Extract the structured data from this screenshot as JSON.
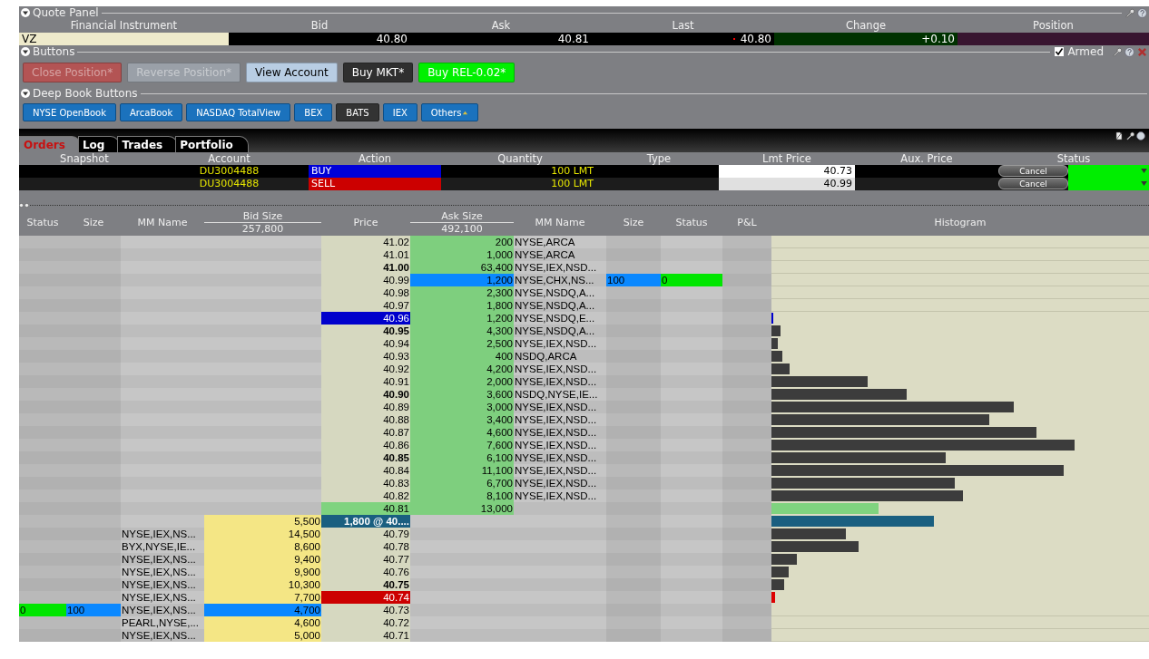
{
  "quote_panel": {
    "title": "Quote Panel",
    "expanded": true,
    "columns": [
      "Financial Instrument",
      "Bid",
      "Ask",
      "Last",
      "Change",
      "Position"
    ],
    "cells": [
      {
        "kind": "symbol",
        "text": "VZ"
      },
      {
        "kind": "price",
        "text": "40.80"
      },
      {
        "kind": "price",
        "text": "40.81"
      },
      {
        "kind": "last",
        "text": "40.80"
      },
      {
        "kind": "change",
        "text": "+0.10"
      },
      {
        "kind": "position"
      }
    ]
  },
  "buttons_panel": {
    "title": "Buttons",
    "expanded": true,
    "armed": {
      "label": "Armed",
      "checked": true
    },
    "buttons": [
      {
        "label": "Close Position*",
        "color": "#b35454",
        "disabled": true
      },
      {
        "label": "Reverse Position*",
        "color": "#9aa0a8",
        "disabled": true
      },
      {
        "label": "View Account",
        "color": "#b8cde3",
        "disabled": false
      },
      {
        "label": "Buy MKT*",
        "color": "#2f2f2f",
        "disabled": false
      },
      {
        "label": "Buy REL-0.02*",
        "color": "#00f000",
        "disabled": false
      }
    ]
  },
  "deep_book_panel": {
    "title": "Deep Book Buttons",
    "expanded": true,
    "buttons": [
      {
        "label": "NYSE OpenBook",
        "selected": false
      },
      {
        "label": "ArcaBook",
        "selected": false
      },
      {
        "label": "NASDAQ TotalView",
        "selected": false
      },
      {
        "label": "BEX",
        "selected": false
      },
      {
        "label": "BATS",
        "selected": true
      },
      {
        "label": "IEX",
        "selected": false
      },
      {
        "label": "Others",
        "selected": false,
        "menu": true
      }
    ]
  },
  "orders": {
    "tabs": [
      {
        "label": "Orders",
        "selected": true
      },
      {
        "label": "Log",
        "selected": false
      },
      {
        "label": "Trades",
        "selected": false
      },
      {
        "label": "Portfolio",
        "selected": false
      }
    ],
    "columns": [
      "Snapshot",
      "Account",
      "Action",
      "Quantity",
      "Type",
      "Lmt Price",
      "Aux. Price",
      "Status"
    ],
    "rows": [
      {
        "account": "DU3004488",
        "action": "BUY",
        "kind": "buy",
        "quantity": "100 LMT",
        "lmt_price": "40.73",
        "cancel": "Cancel",
        "color": "#00ee00"
      },
      {
        "account": "DU3004488",
        "action": "SELL",
        "kind": "sell",
        "quantity": "100 LMT",
        "lmt_price": "40.99",
        "cancel": "Cancel",
        "color": "#00ee00"
      }
    ]
  },
  "book": {
    "columns": [
      {
        "label": "Status"
      },
      {
        "label": "Size"
      },
      {
        "label": "MM Name"
      },
      {
        "label": "Bid Size",
        "total": "257,800"
      },
      {
        "label": "Price"
      },
      {
        "label": "Ask Size",
        "total": "492,100"
      },
      {
        "label": "MM Name"
      },
      {
        "label": "Size"
      },
      {
        "label": "Status"
      },
      {
        "label": "P&L"
      },
      {
        "label": "Histogram"
      }
    ],
    "rows": [
      {
        "kind": "ask",
        "price": "41.02",
        "bold": false,
        "size": "200",
        "mm": "NYSE,ARCA"
      },
      {
        "kind": "ask",
        "price": "41.01",
        "bold": false,
        "size": "1,000",
        "mm": "NYSE,ARCA"
      },
      {
        "kind": "ask",
        "price": "41.00",
        "bold": true,
        "size": "63,400",
        "mm": "NYSE,IEX,NSD..."
      },
      {
        "kind": "ask",
        "price": "40.99",
        "bold": false,
        "size": "1,200",
        "mm": "NYSE,CHX,NS...",
        "order": {
          "size": "100",
          "status": "0"
        }
      },
      {
        "kind": "ask",
        "price": "40.98",
        "bold": false,
        "size": "2,300",
        "mm": "NYSE,NSDQ,A..."
      },
      {
        "kind": "ask",
        "price": "40.97",
        "bold": false,
        "size": "1,800",
        "mm": "NYSE,NSDQ,A..."
      },
      {
        "kind": "ask",
        "price": "40.96",
        "bold": false,
        "size": "1,200",
        "mm": "NYSE,NSDQ,E...",
        "highlight": {
          "color": "#0000cc"
        },
        "histogram": {
          "level": 0.005,
          "color": "#0000cc"
        }
      },
      {
        "kind": "ask",
        "price": "40.95",
        "bold": true,
        "size": "4,300",
        "mm": "NYSE,NSDQ,A...",
        "histogram": {
          "level": 0.024,
          "color": "#3c3c3c"
        }
      },
      {
        "kind": "ask",
        "price": "40.94",
        "bold": false,
        "size": "2,500",
        "mm": "NYSE,IEX,NSD...",
        "histogram": {
          "level": 0.017,
          "color": "#3c3c3c"
        }
      },
      {
        "kind": "ask",
        "price": "40.93",
        "bold": false,
        "size": "400",
        "mm": "NSDQ,ARCA",
        "histogram": {
          "level": 0.029,
          "color": "#3c3c3c"
        }
      },
      {
        "kind": "ask",
        "price": "40.92",
        "bold": false,
        "size": "4,200",
        "mm": "NYSE,IEX,NSD...",
        "histogram": {
          "level": 0.049,
          "color": "#3c3c3c"
        }
      },
      {
        "kind": "ask",
        "price": "40.91",
        "bold": false,
        "size": "2,000",
        "mm": "NYSE,IEX,NSD...",
        "histogram": {
          "level": 0.255,
          "color": "#3c3c3c"
        }
      },
      {
        "kind": "ask",
        "price": "40.90",
        "bold": true,
        "size": "3,600",
        "mm": "NSDQ,NYSE,IE...",
        "histogram": {
          "level": 0.359,
          "color": "#3c3c3c"
        }
      },
      {
        "kind": "ask",
        "price": "40.89",
        "bold": false,
        "size": "3,000",
        "mm": "NYSE,IEX,NSD...",
        "histogram": {
          "level": 0.643,
          "color": "#3c3c3c"
        }
      },
      {
        "kind": "ask",
        "price": "40.88",
        "bold": false,
        "size": "3,400",
        "mm": "NYSE,IEX,NSD...",
        "histogram": {
          "level": 0.578,
          "color": "#3c3c3c"
        }
      },
      {
        "kind": "ask",
        "price": "40.87",
        "bold": false,
        "size": "4,600",
        "mm": "NYSE,IEX,NSD...",
        "histogram": {
          "level": 0.701,
          "color": "#3c3c3c"
        }
      },
      {
        "kind": "ask",
        "price": "40.86",
        "bold": false,
        "size": "7,600",
        "mm": "NYSE,IEX,NSD...",
        "histogram": {
          "level": 0.803,
          "color": "#3c3c3c"
        }
      },
      {
        "kind": "ask",
        "price": "40.85",
        "bold": true,
        "size": "6,100",
        "mm": "NYSE,IEX,NSD...",
        "histogram": {
          "level": 0.461,
          "color": "#3c3c3c"
        }
      },
      {
        "kind": "ask",
        "price": "40.84",
        "bold": false,
        "size": "11,100",
        "mm": "NYSE,IEX,NSD...",
        "histogram": {
          "level": 0.774,
          "color": "#3c3c3c"
        }
      },
      {
        "kind": "ask",
        "price": "40.83",
        "bold": false,
        "size": "6,700",
        "mm": "NYSE,IEX,NSD...",
        "histogram": {
          "level": 0.485,
          "color": "#3c3c3c"
        }
      },
      {
        "kind": "ask",
        "price": "40.82",
        "bold": false,
        "size": "8,100",
        "mm": "NYSE,IEX,NSD...",
        "histogram": {
          "level": 0.507,
          "color": "#3c3c3c"
        }
      },
      {
        "kind": "best_ask",
        "price": "40.81",
        "bold": false,
        "size": "13,000",
        "histogram": {
          "level": 0.284,
          "color": "#7fd37f"
        }
      },
      {
        "kind": "last",
        "price": "1,800 @ 40....",
        "bold": true,
        "size": "5,500",
        "histogram": {
          "level": 0.43,
          "color": "#1a5f80"
        }
      },
      {
        "kind": "bid",
        "price": "40.79",
        "bold": false,
        "size": "14,500",
        "mm": "NYSE,IEX,NS...",
        "histogram": {
          "level": 0.197,
          "color": "#3c3c3c"
        }
      },
      {
        "kind": "bid",
        "price": "40.78",
        "bold": false,
        "size": "8,600",
        "mm": "BYX,NYSE,IE...",
        "histogram": {
          "level": 0.231,
          "color": "#3c3c3c"
        }
      },
      {
        "kind": "bid",
        "price": "40.77",
        "bold": false,
        "size": "9,400",
        "mm": "NYSE,IEX,NS...",
        "histogram": {
          "level": 0.068,
          "color": "#3c3c3c"
        }
      },
      {
        "kind": "bid",
        "price": "40.76",
        "bold": false,
        "size": "9,900",
        "mm": "NYSE,IEX,NS...",
        "histogram": {
          "level": 0.046,
          "color": "#3c3c3c"
        }
      },
      {
        "kind": "bid",
        "price": "40.75",
        "bold": true,
        "size": "10,300",
        "mm": "NYSE,IEX,NS...",
        "histogram": {
          "level": 0.034,
          "color": "#3c3c3c"
        }
      },
      {
        "kind": "bid",
        "price": "40.74",
        "bold": false,
        "size": "7,700",
        "mm": "NYSE,IEX,NS...",
        "highlight": {
          "color": "#cc0000"
        },
        "histogram": {
          "level": 0.01,
          "color": "#dd0000"
        }
      },
      {
        "kind": "bid",
        "price": "40.73",
        "bold": false,
        "size": "4,700",
        "mm": "NYSE,IEX,NS...",
        "order": {
          "size": "100",
          "status": "0"
        }
      },
      {
        "kind": "bid",
        "price": "40.72",
        "bold": false,
        "size": "4,600",
        "mm": "PEARL,NYSE,..."
      },
      {
        "kind": "bid",
        "price": "40.71",
        "bold": false,
        "size": "5,000",
        "mm": "NYSE,IEX,NS..."
      }
    ]
  }
}
